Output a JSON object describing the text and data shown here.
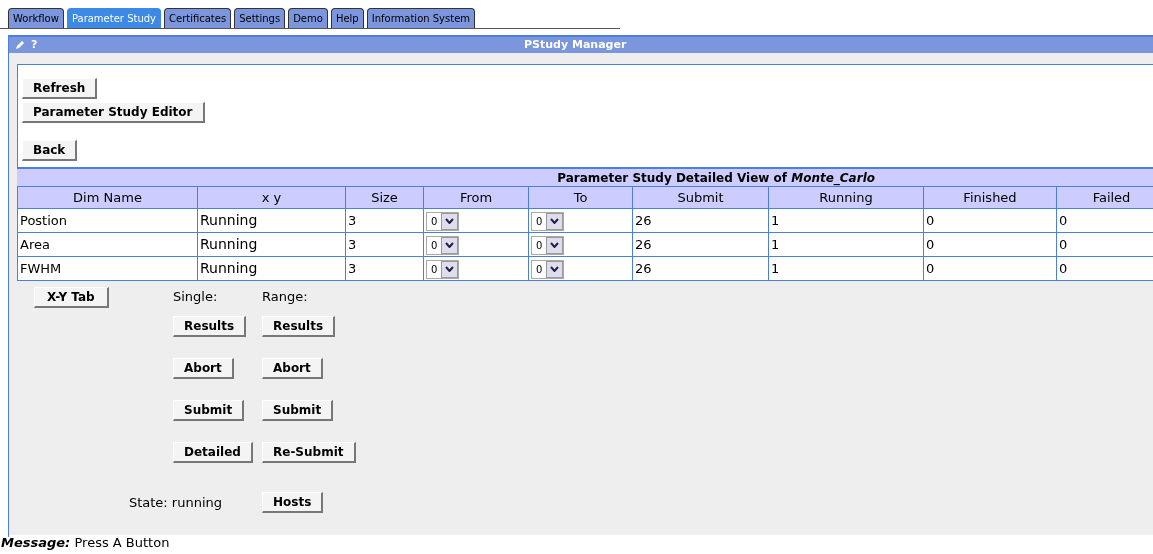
{
  "tabs": [
    {
      "label": "Workflow",
      "selected": false
    },
    {
      "label": "Parameter Study",
      "selected": true
    },
    {
      "label": "Certificates",
      "selected": false
    },
    {
      "label": "Settings",
      "selected": false
    },
    {
      "label": "Demo",
      "selected": false
    },
    {
      "label": "Help",
      "selected": false
    },
    {
      "label": "Information System",
      "selected": false
    }
  ],
  "panel": {
    "help_glyph": "?",
    "title": "PStudy Manager"
  },
  "top_buttons": [
    [
      "Refresh",
      "Parameter Study Editor"
    ],
    [
      "Back"
    ]
  ],
  "table": {
    "title": "Parameter Study Detailed View of *Monte_Carlo*",
    "columns": [
      "Dim Name",
      "x y",
      "Size",
      "From",
      "To",
      "Submit",
      "Running",
      "Finished",
      "Failed"
    ],
    "rows": [
      {
        "dim_name": "Postion",
        "xy": "Running",
        "size": "3",
        "from": "0",
        "to": "0",
        "submit": "26",
        "running": "1",
        "finished": "0",
        "failed": "0"
      },
      {
        "dim_name": "Area",
        "xy": "Running",
        "size": "3",
        "from": "0",
        "to": "0",
        "submit": "26",
        "running": "1",
        "finished": "0",
        "failed": "0"
      },
      {
        "dim_name": "FWHM",
        "xy": "Running",
        "size": "3",
        "from": "0",
        "to": "0",
        "submit": "26",
        "running": "1",
        "finished": "0",
        "failed": "0"
      }
    ]
  },
  "actions": {
    "xy_button": "X-Y Tab",
    "single_label": "Single:",
    "range_label": "Range:",
    "single_buttons": [
      "Results",
      "Abort",
      "Submit",
      "Detailed"
    ],
    "range_buttons": [
      "Results",
      "Abort",
      "Submit",
      "Re-Submit"
    ],
    "state": "State: running",
    "hosts_button": "Hosts"
  },
  "message": {
    "label": "Message:",
    "text": "Press A Button"
  }
}
